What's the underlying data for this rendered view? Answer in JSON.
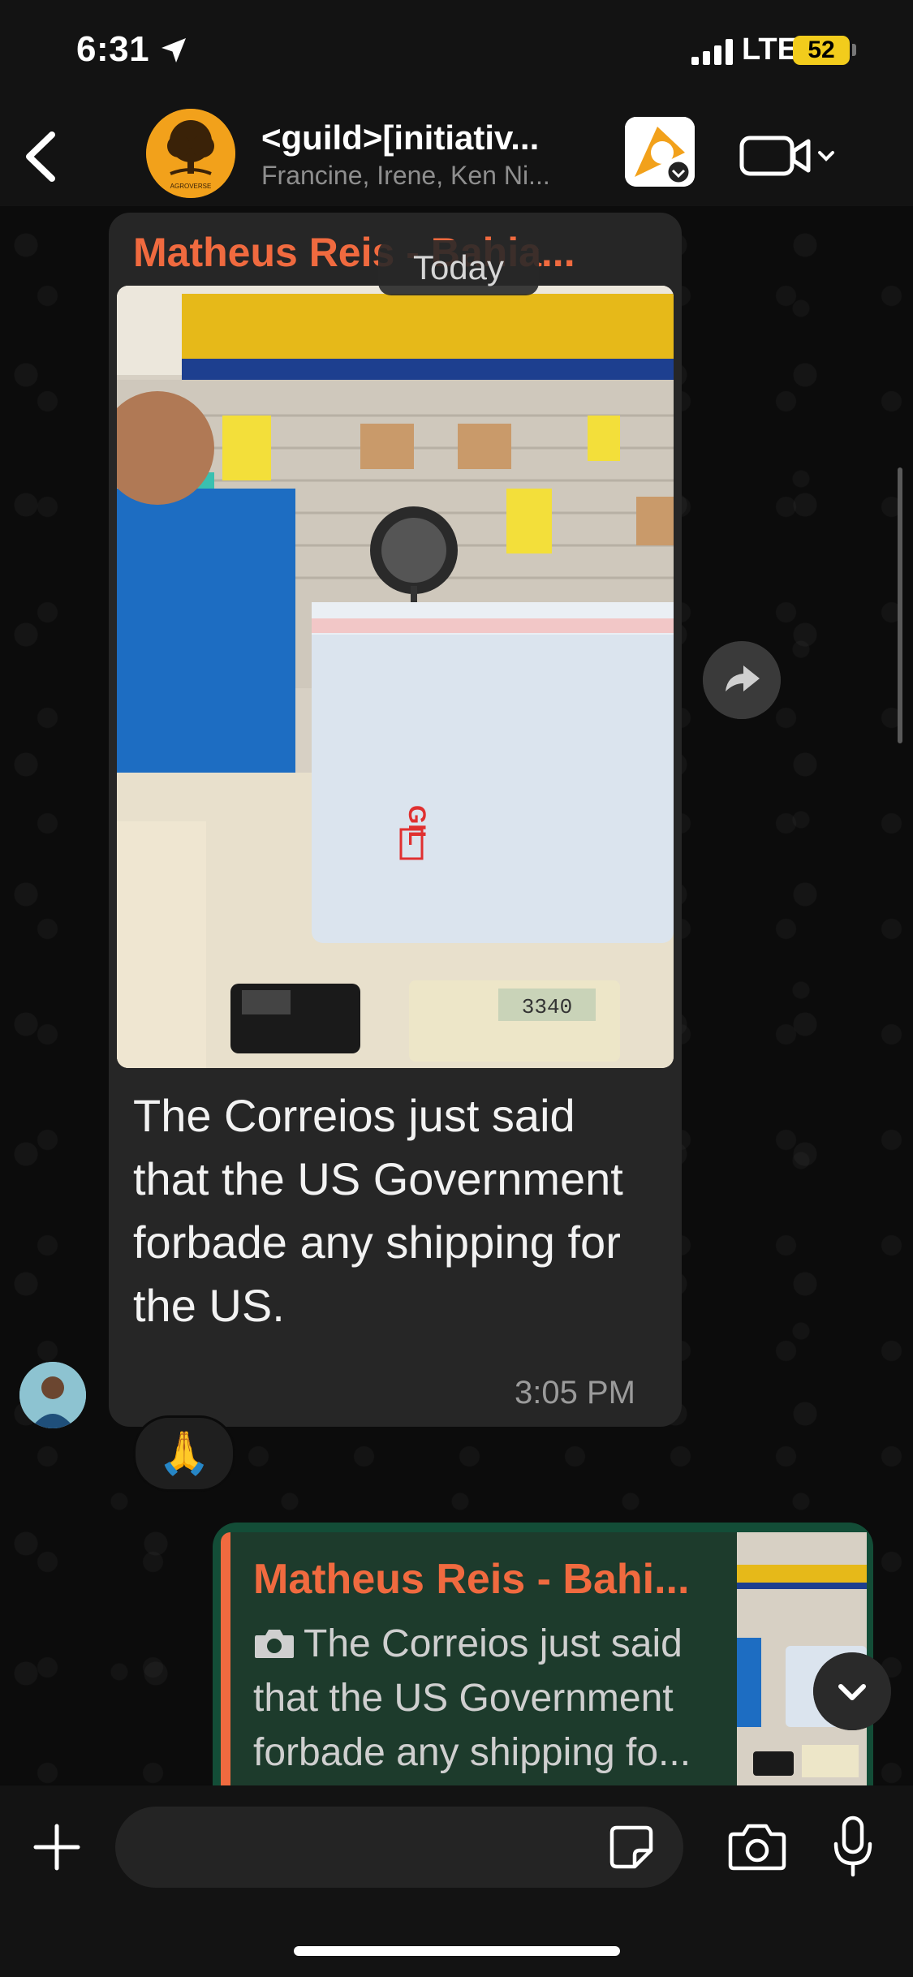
{
  "status_bar": {
    "time": "6:31",
    "network": "LTE",
    "battery": "52"
  },
  "header": {
    "title": "<guild>[initiativ...",
    "subtitle": "Francine, Irene, Ken Ni...",
    "avatar_text": "AGROVERSE"
  },
  "chat": {
    "date_separator": "Today",
    "message": {
      "sender": "Matheus Reis - Bahia...",
      "text": "The Correios just said that the US Government forbade any shipping for the US.",
      "time": "3:05 PM",
      "reaction": "🙏",
      "photo_scale_reading": "3340"
    },
    "reply": {
      "quoted_sender": "Matheus Reis - Bahi...",
      "quoted_text": "The Correios just said that the US Government forbade any shipping fo..."
    }
  },
  "input": {
    "placeholder": ""
  },
  "colors": {
    "sender_name": "#f06a3f",
    "outgoing_bubble": "#134d37",
    "incoming_bubble": "#262626",
    "battery": "#f2cc1c"
  },
  "icons": [
    "location-arrow-icon",
    "signal-icon",
    "battery-icon",
    "back-chevron-icon",
    "group-avatar",
    "community-icon",
    "video-camera-icon",
    "chevron-down-icon",
    "forward-icon",
    "camera-icon",
    "plus-icon",
    "sticker-icon",
    "microphone-icon"
  ]
}
